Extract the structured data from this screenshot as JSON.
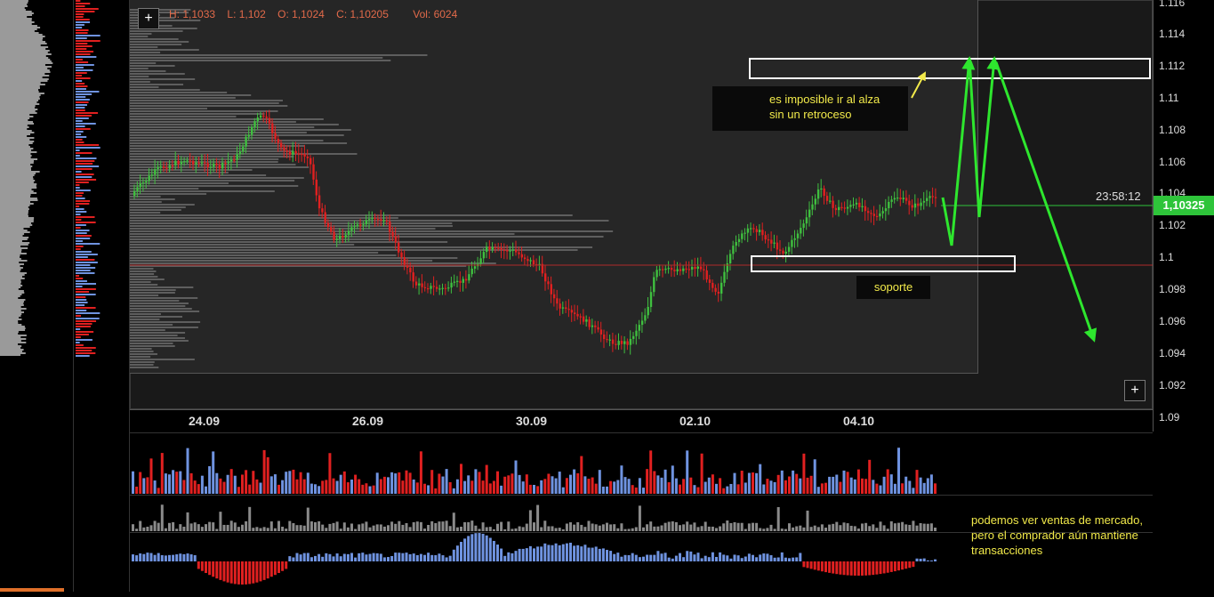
{
  "ohlc": {
    "high": "H: 1,1033",
    "low": "L: 1,102",
    "open": "O: 1,1024",
    "close": "C: 1,10205",
    "volume": "Vol: 6024"
  },
  "price_axis": {
    "ticks": [
      "1.116",
      "1.114",
      "1.112",
      "1.11",
      "1.108",
      "1.106",
      "1.104",
      "1.102",
      "1.1",
      "1.098",
      "1.096",
      "1.094",
      "1.092",
      "1.09"
    ]
  },
  "current_price": "1,10325",
  "countdown": "23:58:12",
  "time_axis": {
    "ticks": [
      "24.09",
      "26.09",
      "30.09",
      "02.10",
      "04.10"
    ]
  },
  "buttons": {
    "plus": "+"
  },
  "annotations": {
    "resistance_line1": "es imposible ir al alza",
    "resistance_line2": "sin un retroceso",
    "support": "soporte",
    "delta_line1": "podemos ver ventas de mercado,",
    "delta_line2": "pero el comprador aún mantiene",
    "delta_line3": "transacciones"
  },
  "colors": {
    "up": "#3fbf3f",
    "down": "#e02020",
    "vol_buy": "#6f93e0",
    "vol_sell": "#e02020",
    "price_tag": "#2ec43a",
    "annotation": "#f2ea4a",
    "arrow": "#2ee62e"
  }
}
